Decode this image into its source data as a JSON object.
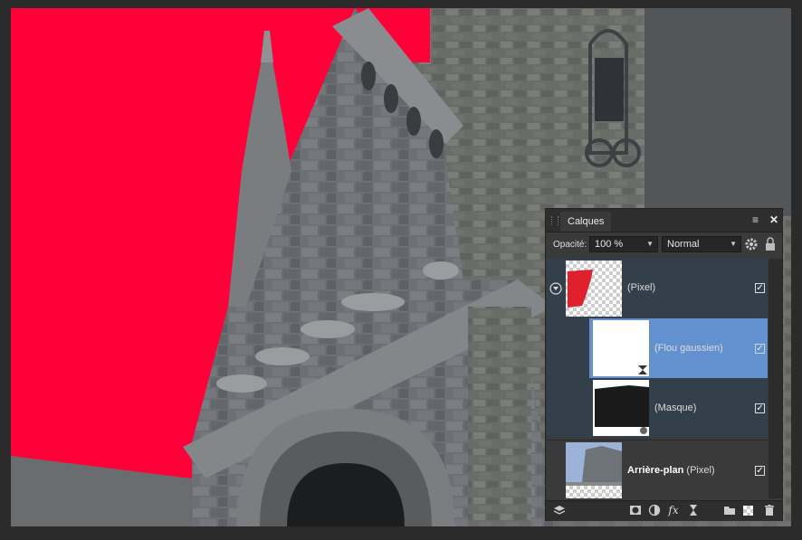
{
  "panel": {
    "tab_label": "Calques",
    "opacity_label": "Opacité:",
    "opacity_value": "100 %",
    "blend_mode": "Normal",
    "menu_icon": "panel-menu-icon",
    "close_icon": "close-icon"
  },
  "layers": [
    {
      "name": "",
      "type": "(Pixel)",
      "checked": true,
      "expanded": true
    },
    {
      "name": "",
      "type": "(Flou gaussien)",
      "checked": true,
      "selected": true
    },
    {
      "name": "",
      "type": "(Masque)",
      "checked": true
    },
    {
      "name": "Arrière-plan",
      "type": "(Pixel)",
      "checked": true
    }
  ],
  "bottom_toolbar": [
    "layer-stack-icon",
    "mask-icon",
    "adjustment-icon",
    "fx-icon",
    "live-filter-icon",
    "folder-icon",
    "pixel-layer-icon",
    "trash-icon"
  ],
  "colors": {
    "red_background": "#ff0038",
    "selected_layer": "#6391cf",
    "panel_bg": "#3a3a3a"
  }
}
